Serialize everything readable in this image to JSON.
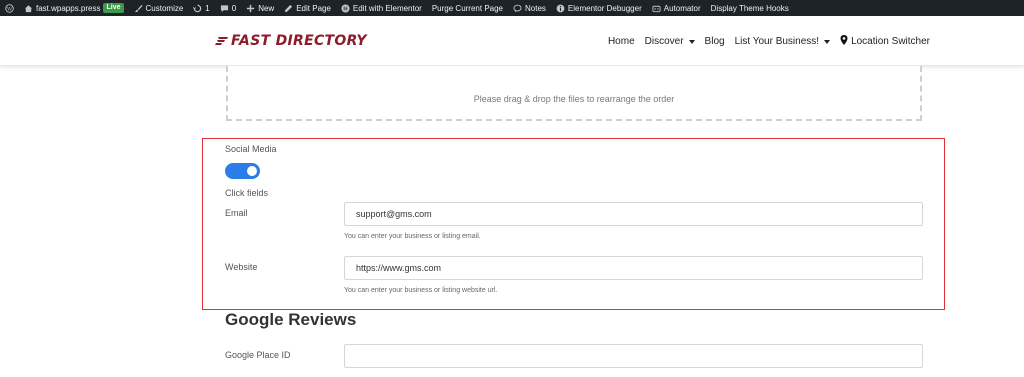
{
  "adminbar": {
    "site": "fast.wpapps.press",
    "live_badge": "Live",
    "customize": "Customize",
    "updates_count": "1",
    "comments_count": "0",
    "new": "New",
    "edit_page": "Edit Page",
    "edit_elementor": "Edit with Elementor",
    "purge": "Purge Current Page",
    "notes": "Notes",
    "elementor_debugger": "Elementor Debugger",
    "automator": "Automator",
    "theme_hooks": "Display Theme Hooks"
  },
  "header": {
    "logo": "FAST DIRECTORY",
    "nav": {
      "home": "Home",
      "discover": "Discover",
      "blog": "Blog",
      "list_business": "List Your Business!",
      "location": "Location Switcher"
    }
  },
  "dropzone": {
    "text": "Please drag & drop the files to rearrange the order"
  },
  "social": {
    "label": "Social Media",
    "toggle_on": true,
    "click_fields": "Click fields",
    "email": {
      "label": "Email",
      "value": "support@gms.com",
      "help": "You can enter your business or listing email."
    },
    "website": {
      "label": "Website",
      "value": "https://www.gms.com",
      "help": "You can enter your business or listing website url."
    }
  },
  "google": {
    "title": "Google Reviews",
    "place_id_label": "Google Place ID",
    "place_id_value": ""
  },
  "colors": {
    "accent": "#2b7de9",
    "highlight": "#e0303a",
    "logo": "#8c1c2a",
    "adminbar": "#1d2327"
  }
}
